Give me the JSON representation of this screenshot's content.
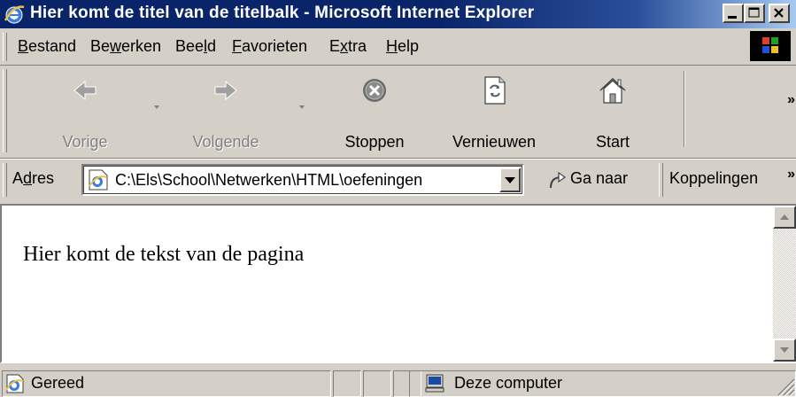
{
  "window": {
    "title": "Hier komt de titel van de titelbalk - Microsoft Internet Explorer",
    "controls": [
      "minimize-icon",
      "maximize-icon",
      "close-icon"
    ]
  },
  "menubar": {
    "items": [
      {
        "label": "Bestand",
        "accesskey": "B"
      },
      {
        "label": "Bewerken",
        "accesskey": "w"
      },
      {
        "label": "Beeld",
        "accesskey": "l"
      },
      {
        "label": "Favorieten",
        "accesskey": "F"
      },
      {
        "label": "Extra",
        "accesskey": "x"
      },
      {
        "label": "Help",
        "accesskey": "H"
      }
    ]
  },
  "toolbar": {
    "back_label": "Vorige",
    "forward_label": "Volgende",
    "stop_label": "Stoppen",
    "refresh_label": "Vernieuwen",
    "home_label": "Start",
    "overflow": "»"
  },
  "address": {
    "label": "Adres",
    "accesskey": "d",
    "value": "C:\\Els\\School\\Netwerken\\HTML\\oefeningen",
    "go_label": "Ga naar",
    "links_label": "Koppelingen",
    "overflow": "»"
  },
  "page": {
    "text": "Hier komt de tekst van de pagina"
  },
  "status": {
    "text": "Gereed",
    "zone": "Deze computer"
  },
  "colors": {
    "titlebar": "#0a246a",
    "face": "#d4d0c8",
    "content_bg": "#ffffff"
  }
}
